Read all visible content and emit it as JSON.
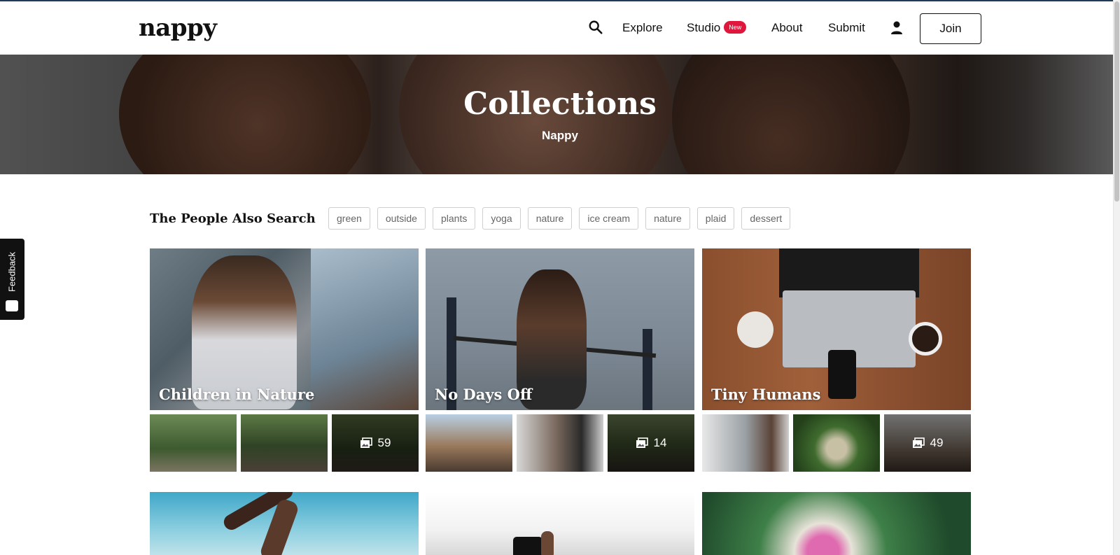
{
  "brand": {
    "logo": "nappy"
  },
  "nav": {
    "search_icon": "search-icon",
    "items": [
      "Explore",
      "Studio",
      "About",
      "Submit"
    ],
    "studio_badge": "New",
    "join_label": "Join",
    "user_icon": "user-icon"
  },
  "hero": {
    "title": "Collections",
    "subtitle": "Nappy"
  },
  "feedback": {
    "label": "Feedback"
  },
  "also_search": {
    "title": "The People Also Search",
    "tags": [
      "green",
      "outside",
      "plants",
      "yoga",
      "nature",
      "ice cream",
      "nature",
      "plaid",
      "dessert"
    ]
  },
  "collections": [
    {
      "title": "Children in Nature",
      "count": "59"
    },
    {
      "title": "No Days Off",
      "count": "14"
    },
    {
      "title": "Tiny Humans",
      "count": "49"
    }
  ],
  "colors": {
    "badge": "#e0173d",
    "text": "#111111",
    "tag_border": "#cfcfcf"
  }
}
